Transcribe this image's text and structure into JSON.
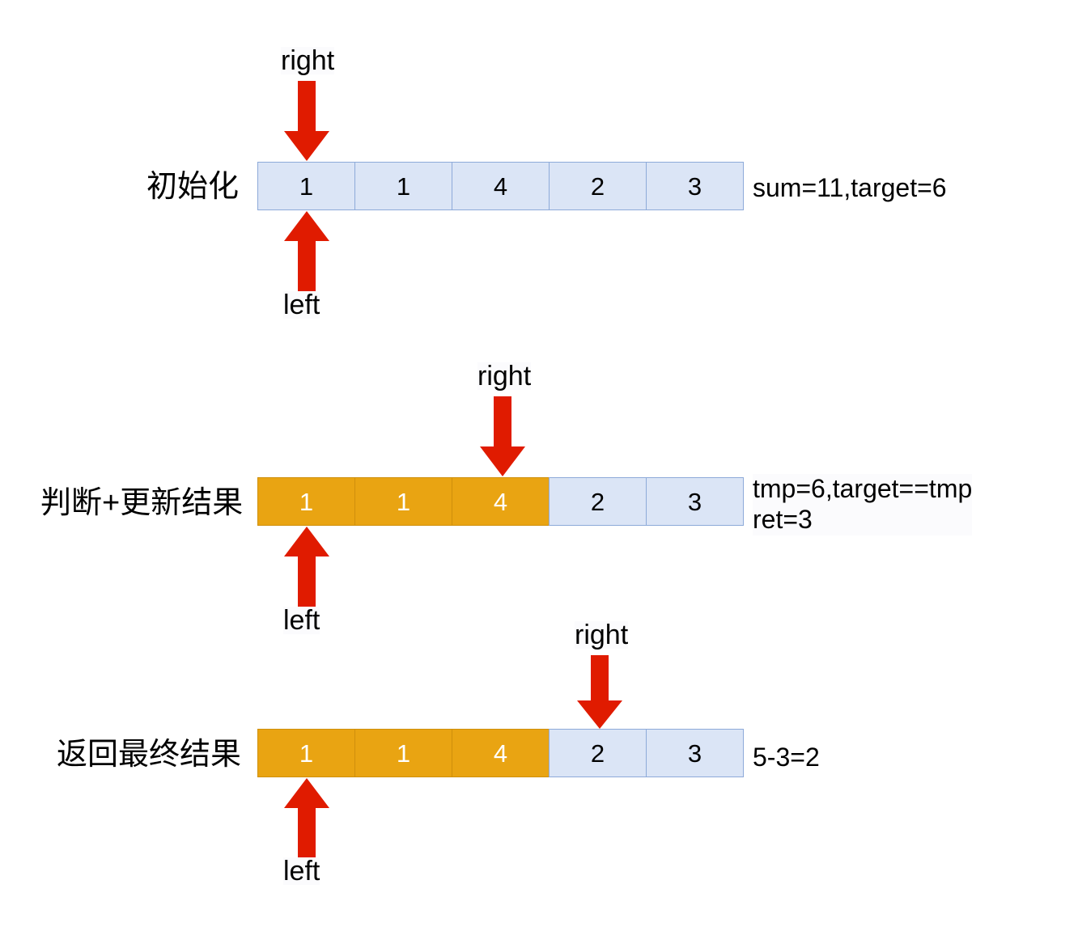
{
  "diagram": {
    "title_hidden": "",
    "colors": {
      "cell_blue_fill": "#dbe5f6",
      "cell_blue_border": "#8daad9",
      "cell_orange_fill": "#e9a412",
      "cell_orange_border": "#cf8f0c",
      "arrow_red": "#e01b00",
      "text_black": "#000000",
      "text_white": "#ffffff"
    },
    "pointer_labels": {
      "left": "left",
      "right": "right"
    },
    "rows": [
      {
        "id": "init",
        "label": "初始化",
        "cells": [
          {
            "value": "1",
            "state": "blue"
          },
          {
            "value": "1",
            "state": "blue"
          },
          {
            "value": "4",
            "state": "blue"
          },
          {
            "value": "2",
            "state": "blue"
          },
          {
            "value": "3",
            "state": "blue"
          }
        ],
        "left_pointer_index": 0,
        "right_pointer_index": 0,
        "note": "sum=11,target=6"
      },
      {
        "id": "judge-update",
        "label": "判断+更新结果",
        "cells": [
          {
            "value": "1",
            "state": "orange"
          },
          {
            "value": "1",
            "state": "orange"
          },
          {
            "value": "4",
            "state": "orange"
          },
          {
            "value": "2",
            "state": "blue"
          },
          {
            "value": "3",
            "state": "blue"
          }
        ],
        "left_pointer_index": 0,
        "right_pointer_index": 2,
        "note": "tmp=6,target==tmp\nret=3"
      },
      {
        "id": "final-result",
        "label": "返回最终结果",
        "cells": [
          {
            "value": "1",
            "state": "orange"
          },
          {
            "value": "1",
            "state": "orange"
          },
          {
            "value": "4",
            "state": "orange"
          },
          {
            "value": "2",
            "state": "blue"
          },
          {
            "value": "3",
            "state": "blue"
          }
        ],
        "left_pointer_index": 0,
        "right_pointer_index": 3,
        "note": "5-3=2"
      }
    ]
  }
}
